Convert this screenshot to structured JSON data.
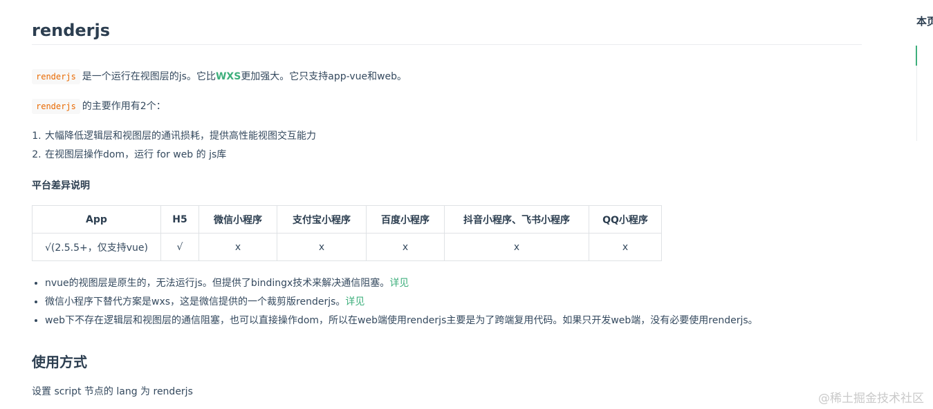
{
  "doc": {
    "title": "renderjs",
    "intro": {
      "code": "renderjs",
      "text_before": "是一个运行在视图层的js。它比",
      "link": "WXS",
      "text_after": "更加强大。它只支持app-vue和web。"
    },
    "purpose": {
      "code": "renderjs",
      "text": "的主要作用有2个："
    },
    "features": [
      "大幅降低逻辑层和视图层的通讯损耗，提供高性能视图交互能力",
      "在视图层操作dom，运行 for web 的 js库"
    ],
    "platform_heading": "平台差异说明",
    "table": {
      "headers": [
        "App",
        "H5",
        "微信小程序",
        "支付宝小程序",
        "百度小程序",
        "抖音小程序、飞书小程序",
        "QQ小程序"
      ],
      "row": [
        "√(2.5.5+，仅支持vue)",
        "√",
        "x",
        "x",
        "x",
        "x",
        "x"
      ]
    },
    "notes": [
      {
        "text": "nvue的视图层是原生的，无法运行js。但提供了bindingx技术来解决通信阻塞。",
        "link": "详见"
      },
      {
        "text": "微信小程序下替代方案是wxs，这是微信提供的一个裁剪版renderjs。",
        "link": "详见"
      },
      {
        "text": "web下不存在逻辑层和视图层的通信阻塞，也可以直接操作dom，所以在web端使用renderjs主要是为了跨端复用代码。如果只开发web端，没有必要使用renderjs。",
        "link": ""
      }
    ],
    "usage_heading": "使用方式",
    "usage_text": "设置 script 节点的 lang 为 renderjs"
  },
  "toc": {
    "title": "本页"
  },
  "watermark": "@稀土掘金技术社区",
  "colors": {
    "accent": "#3eaf7c",
    "code_text": "#e96900",
    "body_text": "#34495e"
  }
}
